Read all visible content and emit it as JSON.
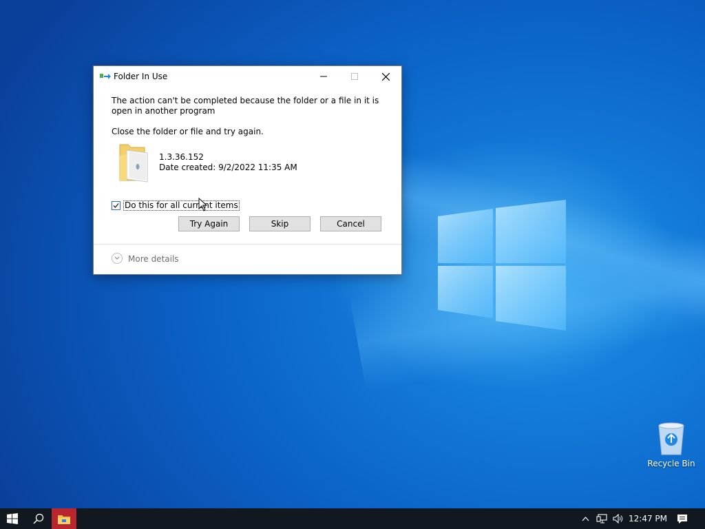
{
  "dialog": {
    "title": "Folder In Use",
    "message": "The action can't be completed because the folder or a file in it is open in another program",
    "instruction": "Close the folder or file and try again.",
    "file_name": "1.3.36.152",
    "file_date": "Date created: 9/2/2022 11:35 AM",
    "checkbox_label": "Do this for all current items",
    "checkbox_checked": true,
    "buttons": {
      "try_again": "Try Again",
      "skip": "Skip",
      "cancel": "Cancel"
    },
    "more_details": "More details"
  },
  "desktop": {
    "recycle_bin_label": "Recycle Bin"
  },
  "taskbar": {
    "time": "12:47 PM",
    "icons": [
      "windows-start-icon",
      "search-icon",
      "file-explorer-icon",
      "chevron-up-icon",
      "network-icon",
      "volume-icon",
      "notification-icon"
    ]
  },
  "colors": {
    "desktop_blue": "#0b63c8",
    "taskbar": "#111820",
    "explorer_active": "#b8262e",
    "checkbox_accent": "#2f6cc0"
  }
}
